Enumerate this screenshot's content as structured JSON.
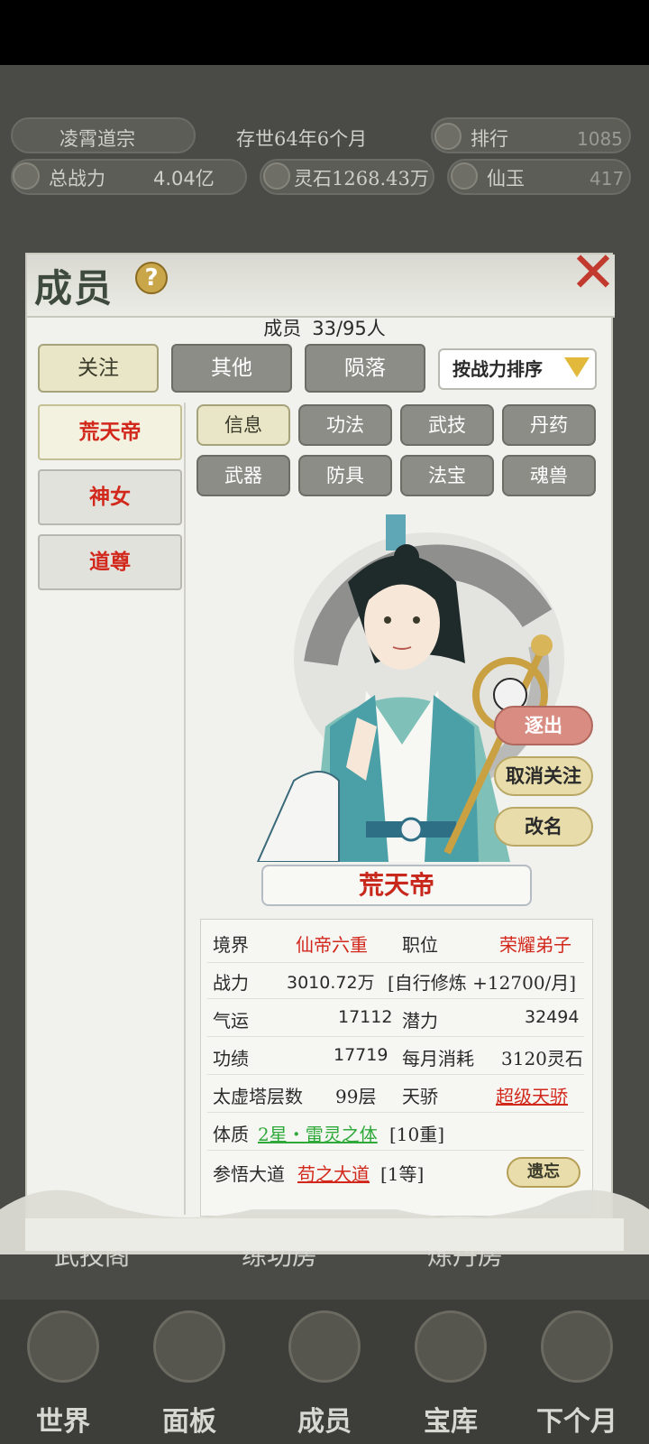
{
  "header": {
    "sect_name": "凌霄道宗",
    "age": "存世64年6个月",
    "rank_label": "排行",
    "rank_value": "1085",
    "power_label": "总战力",
    "power_value": "4.04亿",
    "spirit_stone": "灵石1268.43万",
    "jade_label": "仙玉",
    "jade_value": "417"
  },
  "modal": {
    "title": "成员",
    "member_label": "成员",
    "member_count": "33/95人",
    "filter_tabs": [
      "关注",
      "其他",
      "陨落"
    ],
    "sort_label": "按战力排序",
    "members": [
      "荒天帝",
      "神女",
      "道尊"
    ],
    "detail_tabs_row1": [
      "信息",
      "功法",
      "武技",
      "丹药"
    ],
    "detail_tabs_row2": [
      "武器",
      "防具",
      "法宝",
      "魂兽"
    ],
    "actions": [
      "逐出",
      "取消关注",
      "改名"
    ],
    "selected_name": "荒天帝",
    "stats": {
      "realm_label": "境界",
      "realm_value": "仙帝六重",
      "position_label": "职位",
      "position_value": "荣耀弟子",
      "power_label": "战力",
      "power_value": "3010.72万",
      "train_value": "[自行修炼 +12700/月]",
      "luck_label": "气运",
      "luck_value": "17112",
      "potential_label": "潜力",
      "potential_value": "32494",
      "merit_label": "功绩",
      "merit_value": "17719",
      "cost_label": "每月消耗",
      "cost_value": "3120灵石",
      "tower_label": "太虚塔层数",
      "tower_value": "99层",
      "talent_label": "天骄",
      "talent_value": "超级天骄",
      "physique_label": "体质",
      "physique_value": "2星・雷灵之体",
      "physique_level": "[10重]",
      "dao_label": "参悟大道",
      "dao_value": "苟之大道",
      "dao_level": "[1等]",
      "forget_label": "遗忘"
    }
  },
  "background": {
    "labels": [
      "武技阁",
      "练功房",
      "炼丹房"
    ]
  },
  "bottom_nav": [
    "世界",
    "面板",
    "成员",
    "宝库",
    "下个月"
  ]
}
